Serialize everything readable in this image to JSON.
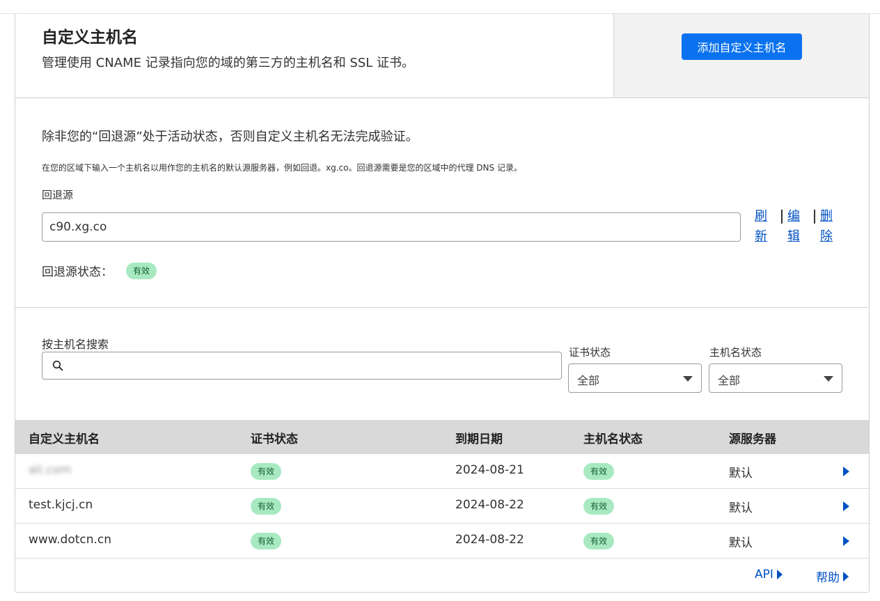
{
  "header": {
    "title": "自定义主机名",
    "description": "管理使用 CNAME 记录指向您的域的第三方的主机名和 SSL 证书。",
    "add_button": "添加自定义主机名"
  },
  "fallback": {
    "warning": "除非您的“回退源”处于活动状态，否则自定义主机名无法完成验证。",
    "help_text": "在您的区域下输入一个主机名以用作您的主机名的默认源服务器，例如回退。xg.co。回退源需要是您的区域中的代理 DNS 记录。",
    "label": "回退源",
    "value": "c90.xg.co",
    "refresh_link": "刷新",
    "edit_link": "编辑",
    "delete_link": "删除",
    "status_label": "回退源状态：",
    "status_value": "有效"
  },
  "filters": {
    "search_label": "按主机名搜索",
    "search_placeholder": "",
    "cert_status_label": "证书状态",
    "cert_status_value": "全部",
    "hostname_status_label": "主机名状态",
    "hostname_status_value": "全部"
  },
  "table": {
    "columns": [
      "自定义主机名",
      "证书状态",
      "到期日期",
      "主机名状态",
      "源服务器"
    ],
    "rows": [
      {
        "hostname": "ali.com",
        "cert_status": "有效",
        "expiry": "2024-08-21",
        "hostname_status": "有效",
        "origin": "默认"
      },
      {
        "hostname": "test.kjcj.cn",
        "cert_status": "有效",
        "expiry": "2024-08-22",
        "hostname_status": "有效",
        "origin": "默认"
      },
      {
        "hostname": "www.dotcn.cn",
        "cert_status": "有效",
        "expiry": "2024-08-22",
        "hostname_status": "有效",
        "origin": "默认"
      }
    ]
  },
  "footer": {
    "api_link": "API",
    "help_link": "帮助"
  },
  "colors": {
    "accent": "#0a72ef",
    "link": "#0051c3",
    "badge_bg": "#a8e9c2",
    "badge_text": "#145f30",
    "table_header_bg": "#d9d9d9"
  }
}
